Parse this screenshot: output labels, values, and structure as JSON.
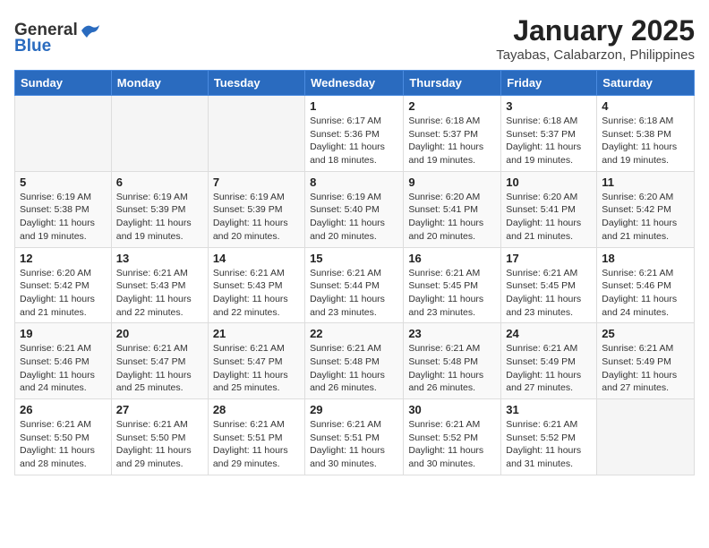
{
  "header": {
    "logo_general": "General",
    "logo_blue": "Blue",
    "month_title": "January 2025",
    "location": "Tayabas, Calabarzon, Philippines"
  },
  "days_of_week": [
    "Sunday",
    "Monday",
    "Tuesday",
    "Wednesday",
    "Thursday",
    "Friday",
    "Saturday"
  ],
  "weeks": [
    [
      {
        "day": "",
        "info": ""
      },
      {
        "day": "",
        "info": ""
      },
      {
        "day": "",
        "info": ""
      },
      {
        "day": "1",
        "info": "Sunrise: 6:17 AM\nSunset: 5:36 PM\nDaylight: 11 hours\nand 18 minutes."
      },
      {
        "day": "2",
        "info": "Sunrise: 6:18 AM\nSunset: 5:37 PM\nDaylight: 11 hours\nand 19 minutes."
      },
      {
        "day": "3",
        "info": "Sunrise: 6:18 AM\nSunset: 5:37 PM\nDaylight: 11 hours\nand 19 minutes."
      },
      {
        "day": "4",
        "info": "Sunrise: 6:18 AM\nSunset: 5:38 PM\nDaylight: 11 hours\nand 19 minutes."
      }
    ],
    [
      {
        "day": "5",
        "info": "Sunrise: 6:19 AM\nSunset: 5:38 PM\nDaylight: 11 hours\nand 19 minutes."
      },
      {
        "day": "6",
        "info": "Sunrise: 6:19 AM\nSunset: 5:39 PM\nDaylight: 11 hours\nand 19 minutes."
      },
      {
        "day": "7",
        "info": "Sunrise: 6:19 AM\nSunset: 5:39 PM\nDaylight: 11 hours\nand 20 minutes."
      },
      {
        "day": "8",
        "info": "Sunrise: 6:19 AM\nSunset: 5:40 PM\nDaylight: 11 hours\nand 20 minutes."
      },
      {
        "day": "9",
        "info": "Sunrise: 6:20 AM\nSunset: 5:41 PM\nDaylight: 11 hours\nand 20 minutes."
      },
      {
        "day": "10",
        "info": "Sunrise: 6:20 AM\nSunset: 5:41 PM\nDaylight: 11 hours\nand 21 minutes."
      },
      {
        "day": "11",
        "info": "Sunrise: 6:20 AM\nSunset: 5:42 PM\nDaylight: 11 hours\nand 21 minutes."
      }
    ],
    [
      {
        "day": "12",
        "info": "Sunrise: 6:20 AM\nSunset: 5:42 PM\nDaylight: 11 hours\nand 21 minutes."
      },
      {
        "day": "13",
        "info": "Sunrise: 6:21 AM\nSunset: 5:43 PM\nDaylight: 11 hours\nand 22 minutes."
      },
      {
        "day": "14",
        "info": "Sunrise: 6:21 AM\nSunset: 5:43 PM\nDaylight: 11 hours\nand 22 minutes."
      },
      {
        "day": "15",
        "info": "Sunrise: 6:21 AM\nSunset: 5:44 PM\nDaylight: 11 hours\nand 23 minutes."
      },
      {
        "day": "16",
        "info": "Sunrise: 6:21 AM\nSunset: 5:45 PM\nDaylight: 11 hours\nand 23 minutes."
      },
      {
        "day": "17",
        "info": "Sunrise: 6:21 AM\nSunset: 5:45 PM\nDaylight: 11 hours\nand 23 minutes."
      },
      {
        "day": "18",
        "info": "Sunrise: 6:21 AM\nSunset: 5:46 PM\nDaylight: 11 hours\nand 24 minutes."
      }
    ],
    [
      {
        "day": "19",
        "info": "Sunrise: 6:21 AM\nSunset: 5:46 PM\nDaylight: 11 hours\nand 24 minutes."
      },
      {
        "day": "20",
        "info": "Sunrise: 6:21 AM\nSunset: 5:47 PM\nDaylight: 11 hours\nand 25 minutes."
      },
      {
        "day": "21",
        "info": "Sunrise: 6:21 AM\nSunset: 5:47 PM\nDaylight: 11 hours\nand 25 minutes."
      },
      {
        "day": "22",
        "info": "Sunrise: 6:21 AM\nSunset: 5:48 PM\nDaylight: 11 hours\nand 26 minutes."
      },
      {
        "day": "23",
        "info": "Sunrise: 6:21 AM\nSunset: 5:48 PM\nDaylight: 11 hours\nand 26 minutes."
      },
      {
        "day": "24",
        "info": "Sunrise: 6:21 AM\nSunset: 5:49 PM\nDaylight: 11 hours\nand 27 minutes."
      },
      {
        "day": "25",
        "info": "Sunrise: 6:21 AM\nSunset: 5:49 PM\nDaylight: 11 hours\nand 27 minutes."
      }
    ],
    [
      {
        "day": "26",
        "info": "Sunrise: 6:21 AM\nSunset: 5:50 PM\nDaylight: 11 hours\nand 28 minutes."
      },
      {
        "day": "27",
        "info": "Sunrise: 6:21 AM\nSunset: 5:50 PM\nDaylight: 11 hours\nand 29 minutes."
      },
      {
        "day": "28",
        "info": "Sunrise: 6:21 AM\nSunset: 5:51 PM\nDaylight: 11 hours\nand 29 minutes."
      },
      {
        "day": "29",
        "info": "Sunrise: 6:21 AM\nSunset: 5:51 PM\nDaylight: 11 hours\nand 30 minutes."
      },
      {
        "day": "30",
        "info": "Sunrise: 6:21 AM\nSunset: 5:52 PM\nDaylight: 11 hours\nand 30 minutes."
      },
      {
        "day": "31",
        "info": "Sunrise: 6:21 AM\nSunset: 5:52 PM\nDaylight: 11 hours\nand 31 minutes."
      },
      {
        "day": "",
        "info": ""
      }
    ]
  ]
}
